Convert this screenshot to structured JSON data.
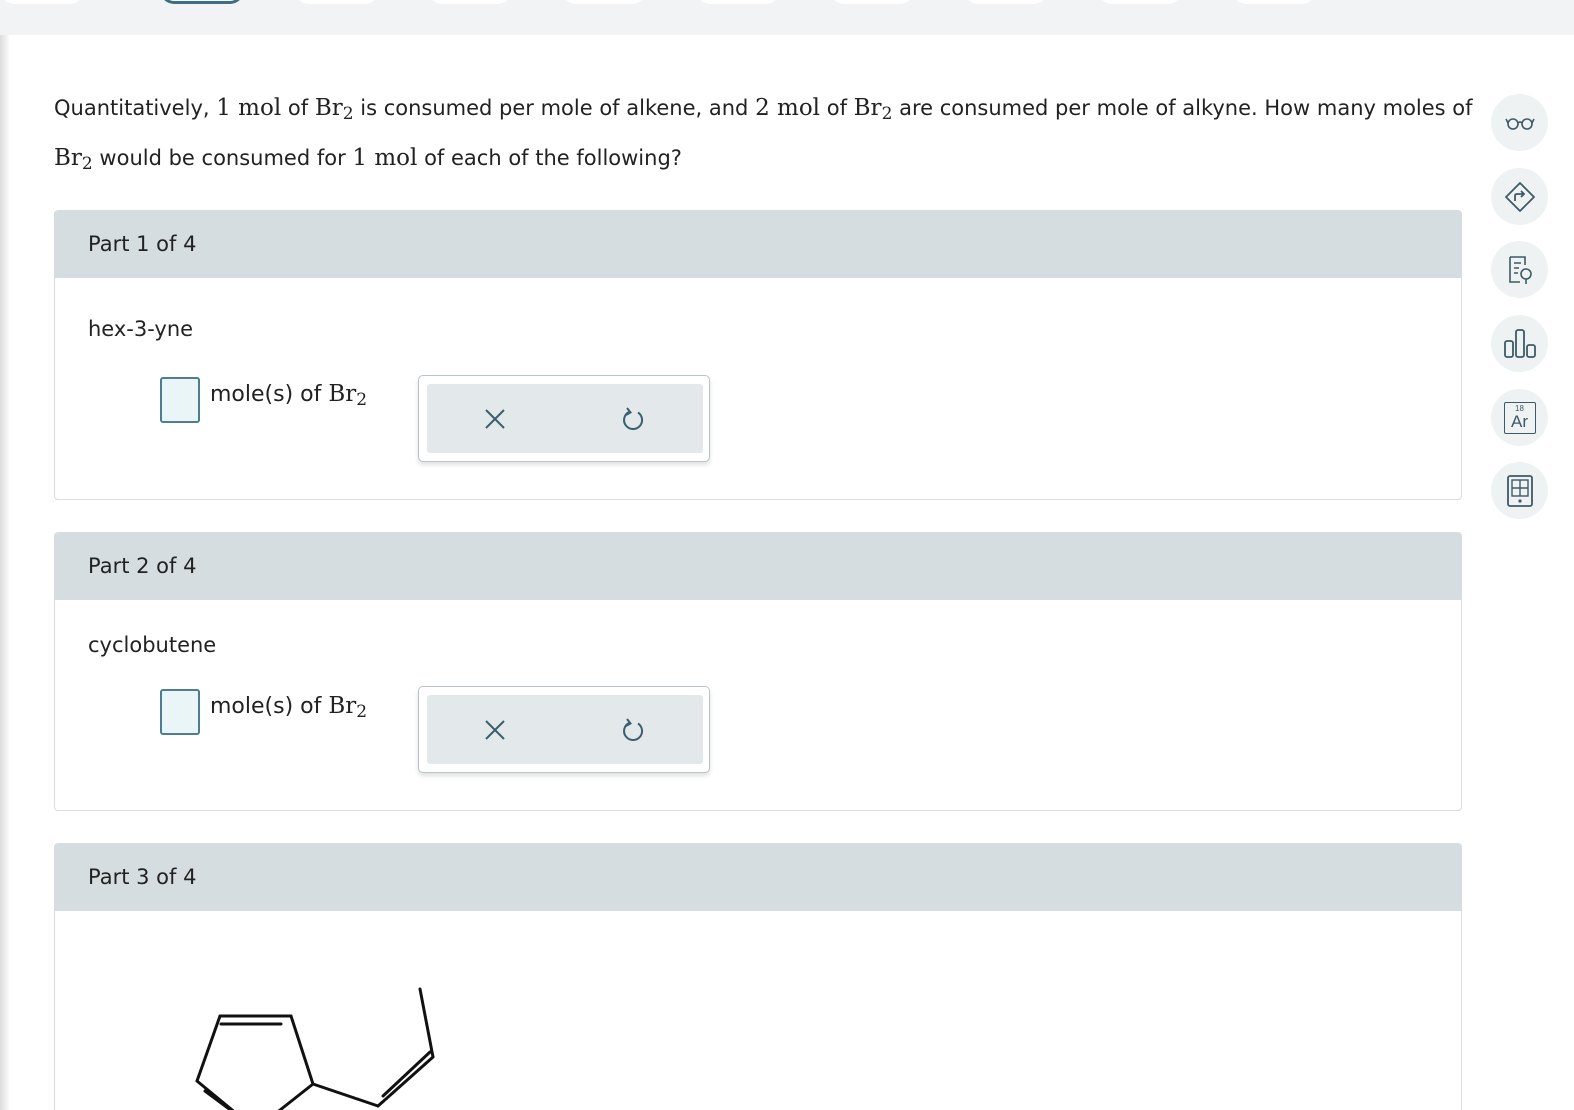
{
  "question": {
    "t1": "Quantitatively,",
    "q1": "1 mol",
    "t2": "of",
    "br": "Br",
    "sub2": "2",
    "t3": "is consumed per mole of alkene, and",
    "q2": "2 mol",
    "t4": "of",
    "t5": "are consumed per mole of alkyne. How many",
    "t6": "moles of",
    "t7": "would be consumed for",
    "q3": "1 mol",
    "t8": "of each of the following?"
  },
  "parts": [
    {
      "header": "Part 1 of 4",
      "compound": "hex-3-yne",
      "answer_value": "",
      "unit_text": "mole(s) of",
      "unit_formula": "Br",
      "unit_sub": "2"
    },
    {
      "header": "Part 2 of 4",
      "compound": "cyclobutene",
      "answer_value": "",
      "unit_text": "mole(s) of",
      "unit_formula": "Br",
      "unit_sub": "2"
    },
    {
      "header": "Part 3 of 4"
    }
  ],
  "tools": {
    "clear_icon": "close-icon",
    "undo_icon": "undo-icon"
  },
  "sidebar": {
    "items": [
      {
        "icon": "glasses-icon"
      },
      {
        "icon": "directions-icon"
      },
      {
        "icon": "reference-icon"
      },
      {
        "icon": "bar-chart-icon"
      },
      {
        "icon": "periodic-table-icon",
        "number": "18",
        "symbol": "Ar"
      },
      {
        "icon": "calculator-icon"
      }
    ]
  },
  "colors": {
    "accent": "#3d6f82",
    "header_bg": "#d5dde0",
    "input_bg": "#eaf5f8",
    "tool_bg": "#e3e8ea"
  }
}
